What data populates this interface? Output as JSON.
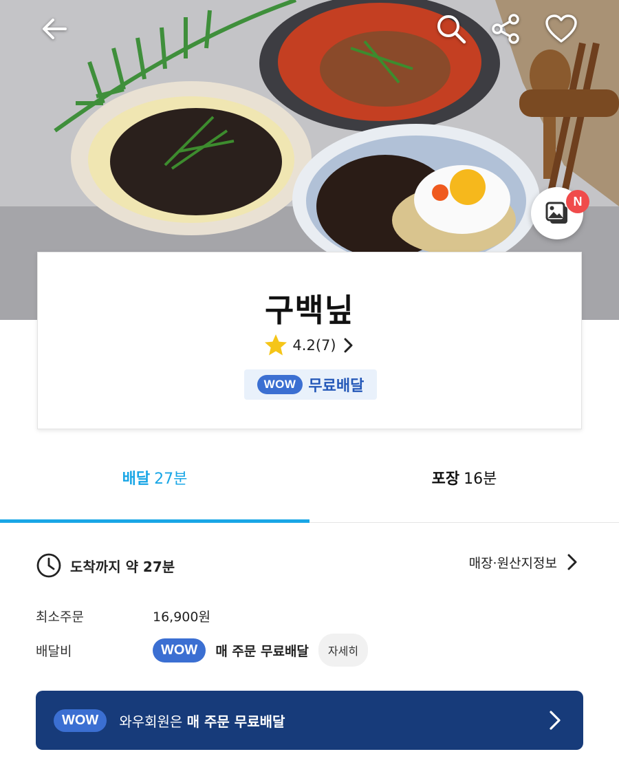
{
  "store": {
    "name": "구백닢",
    "rating": "4.2(7)",
    "wow_badge": "WOW",
    "free_delivery_label": "무료배달"
  },
  "tabs": [
    {
      "label": "배달",
      "time": "27분",
      "active": true
    },
    {
      "label": "포장",
      "time": "16분",
      "active": false
    }
  ],
  "eta": {
    "text": "도착까지 약 27분"
  },
  "store_info_link": "매장·원산지정보",
  "min_order": {
    "label": "최소주문",
    "value": "16,900원"
  },
  "delivery_fee": {
    "label": "배달비",
    "badge": "WOW",
    "value": "매 주문 무료배달",
    "detail_button": "자세히"
  },
  "banner": {
    "badge": "WOW",
    "text_prefix": "와우회원은",
    "text_bold": "매 주문 무료배달"
  },
  "gallery": {
    "badge": "N"
  },
  "icons": {
    "back": "back-arrow-icon",
    "search": "search-icon",
    "share": "share-icon",
    "favorite": "heart-icon",
    "star": "star-icon",
    "clock": "clock-icon",
    "gallery": "gallery-icon"
  },
  "colors": {
    "accent": "#19a6e6",
    "wow_blue": "#3b6fd2",
    "banner_navy": "#173b7a",
    "star": "#f5c518",
    "badge_red": "#f04b4b"
  }
}
